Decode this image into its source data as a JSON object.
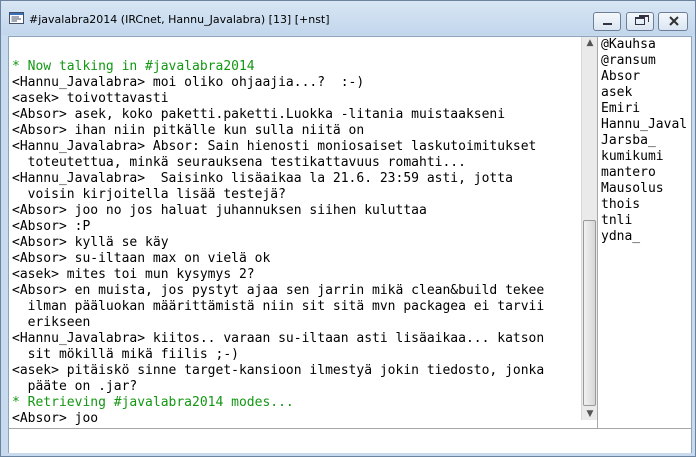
{
  "window": {
    "title": "#javalabra2014 (IRCnet, Hannu_Javalabra) [13] [+nst]"
  },
  "icons": {
    "app": "channel-window-icon",
    "minimize": "minimize-icon",
    "maximize": "maximize-icon",
    "close": "close-icon",
    "scroll_up": "scroll-up-arrow-icon",
    "scroll_down": "scroll-down-arrow-icon"
  },
  "colors": {
    "system_message": "#139713",
    "text": "#000000",
    "background": "#ffffff"
  },
  "chat": {
    "lines": [
      {
        "text": "* Now talking in #javalabra2014",
        "type": "sys"
      },
      {
        "text": "<Hannu_Javalabra> moi oliko ohjaajia...?  :-)",
        "type": "msg"
      },
      {
        "text": "<asek> toivottavasti",
        "type": "msg"
      },
      {
        "text": "<Absor> asek, koko paketti.paketti.Luokka -litania muistaakseni",
        "type": "msg"
      },
      {
        "text": "<Absor> ihan niin pitkälle kun sulla niitä on",
        "type": "msg"
      },
      {
        "text": "<Hannu_Javalabra> Absor: Sain hienosti moniosaiset laskutoimitukset",
        "type": "msg"
      },
      {
        "text": "  toteutettua, minkä seurauksena testikattavuus romahti...",
        "type": "msg"
      },
      {
        "text": "<Hannu_Javalabra>  Saisinko lisäaikaa la 21.6. 23:59 asti, jotta",
        "type": "msg"
      },
      {
        "text": "  voisin kirjoitella lisää testejä?",
        "type": "msg"
      },
      {
        "text": "<Absor> joo no jos haluat juhannuksen siihen kuluttaa",
        "type": "msg"
      },
      {
        "text": "<Absor> :P",
        "type": "msg"
      },
      {
        "text": "<Absor> kyllä se käy",
        "type": "msg"
      },
      {
        "text": "<Absor> su-iltaan max on vielä ok",
        "type": "msg"
      },
      {
        "text": "<asek> mites toi mun kysymys 2?",
        "type": "msg"
      },
      {
        "text": "<Absor> en muista, jos pystyt ajaa sen jarrin mikä clean&build tekee",
        "type": "msg"
      },
      {
        "text": "  ilman pääluokan määrittämistä niin sit sitä mvn packagea ei tarvii",
        "type": "msg"
      },
      {
        "text": "  erikseen",
        "type": "msg"
      },
      {
        "text": "<Hannu_Javalabra> kiitos.. varaan su-iltaan asti lisäaikaa... katson",
        "type": "msg"
      },
      {
        "text": "  sit mökillä mikä fiilis ;-)",
        "type": "msg"
      },
      {
        "text": "<asek> pitäiskö sinne target-kansioon ilmestyä jokin tiedosto, jonka",
        "type": "msg"
      },
      {
        "text": "  pääte on .jar?",
        "type": "msg"
      },
      {
        "text": "* Retrieving #javalabra2014 modes...",
        "type": "sys"
      },
      {
        "text": "<Absor> joo",
        "type": "msg"
      }
    ],
    "scroll_position": 1.0
  },
  "nicklist": {
    "nicks": [
      "@Kauhsa",
      "@ransum",
      "Absor",
      "asek",
      "Emiri",
      "Hannu_Javal",
      "Jarsba_",
      "kumikumi",
      "mantero",
      "Mausolus",
      "thois",
      "tnli",
      "ydna_"
    ]
  },
  "input": {
    "value": ""
  }
}
